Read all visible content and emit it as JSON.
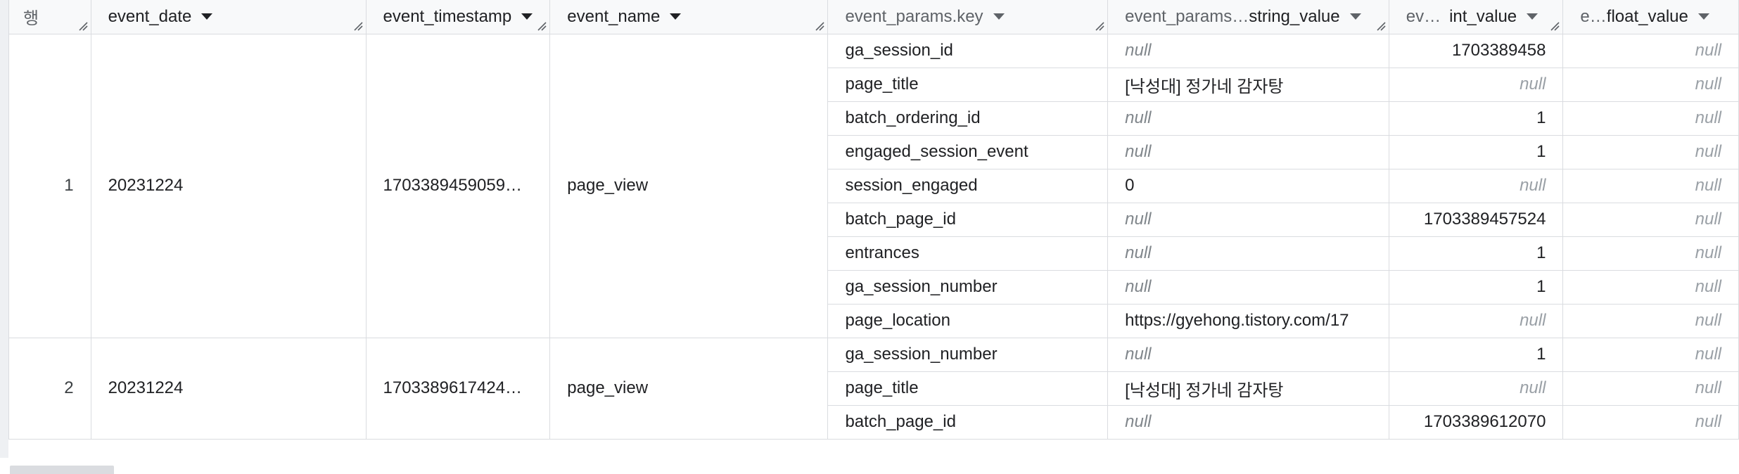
{
  "columns": [
    {
      "label": "행"
    },
    {
      "label": "event_date"
    },
    {
      "label": "event_timestamp"
    },
    {
      "label": "event_name"
    },
    {
      "label": "event_params.key"
    },
    {
      "label_prefix": "event_params…",
      "label": "string_value"
    },
    {
      "label_prefix": "ev…",
      "label": "int_value"
    },
    {
      "label_prefix": "e…",
      "label": "float_value"
    }
  ],
  "rows": [
    {
      "row": "1",
      "event_date": "20231224",
      "event_timestamp": "1703389459059…",
      "event_name": "page_view",
      "params": [
        {
          "key": "ga_session_id",
          "string_value": "null",
          "int_value": "1703389458",
          "float_value": "null"
        },
        {
          "key": "page_title",
          "string_value": "[낙성대] 정가네 감자탕",
          "int_value": "null",
          "float_value": "null"
        },
        {
          "key": "batch_ordering_id",
          "string_value": "null",
          "int_value": "1",
          "float_value": "null"
        },
        {
          "key": "engaged_session_event",
          "string_value": "null",
          "int_value": "1",
          "float_value": "null"
        },
        {
          "key": "session_engaged",
          "string_value": "0",
          "int_value": "null",
          "float_value": "null"
        },
        {
          "key": "batch_page_id",
          "string_value": "null",
          "int_value": "1703389457524",
          "float_value": "null"
        },
        {
          "key": "entrances",
          "string_value": "null",
          "int_value": "1",
          "float_value": "null"
        },
        {
          "key": "ga_session_number",
          "string_value": "null",
          "int_value": "1",
          "float_value": "null"
        },
        {
          "key": "page_location",
          "string_value": "https://gyehong.tistory.com/17",
          "int_value": "null",
          "float_value": "null"
        }
      ]
    },
    {
      "row": "2",
      "event_date": "20231224",
      "event_timestamp": "1703389617424…",
      "event_name": "page_view",
      "params": [
        {
          "key": "ga_session_number",
          "string_value": "null",
          "int_value": "1",
          "float_value": "null"
        },
        {
          "key": "page_title",
          "string_value": "[낙성대] 정가네 감자탕",
          "int_value": "null",
          "float_value": "null"
        },
        {
          "key": "batch_page_id",
          "string_value": "null",
          "int_value": "1703389612070",
          "float_value": "null"
        }
      ]
    }
  ],
  "colors": {
    "border": "#dadce0",
    "header_bg": "#f8f9fa",
    "null_text": "#80868b"
  }
}
